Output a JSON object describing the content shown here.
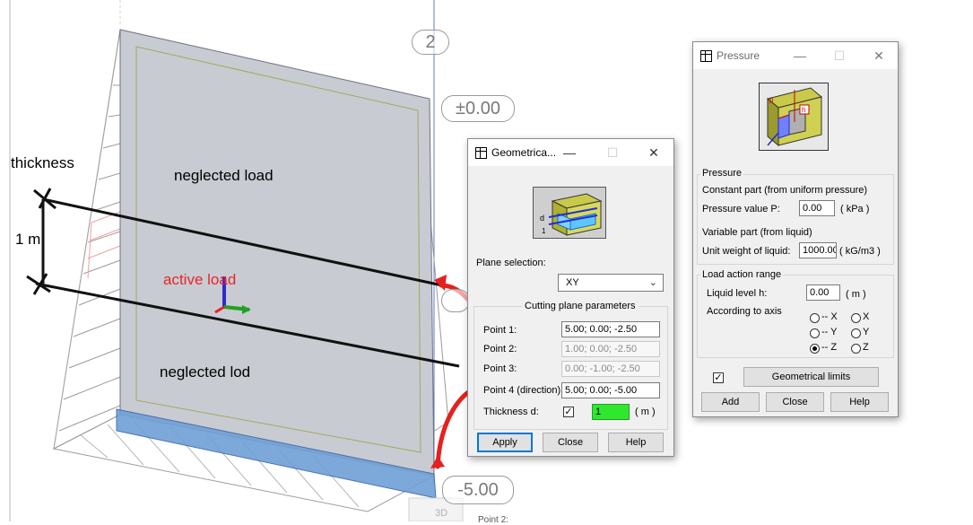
{
  "viewport": {
    "level_labels": [
      "2",
      "±0.00",
      "-5.00"
    ],
    "tab_label": "3D",
    "bottom_text": "Point 2:",
    "annotations": {
      "thickness": "thickness",
      "one_m": "1 m",
      "neglected_load_top": "neglected load",
      "active_load": "active load",
      "neglected_load_bottom": "neglected lod"
    },
    "colors": {
      "wall": "#c8cbd2",
      "foundation": "#6f9fd6",
      "active_load": "#e8262a",
      "arrow": "#e5211f"
    }
  },
  "geometrical": {
    "title": "Geometrica...",
    "plane_selection_label": "Plane selection:",
    "plane_value": "XY",
    "group_title": "Cutting plane parameters",
    "point1_label": "Point 1:",
    "point1_value": "5.00; 0.00; -2.50",
    "point2_label": "Point 2:",
    "point2_value": "1.00; 0.00; -2.50",
    "point3_label": "Point 3:",
    "point3_value": "0.00; -1.00; -2.50",
    "point4_label": "Point 4 (direction):",
    "point4_value": "5.00; 0.00; -5.00",
    "thickness_label": "Thickness d:",
    "thickness_value": "1",
    "thickness_unit": "( m )",
    "apply": "Apply",
    "close": "Close",
    "help": "Help"
  },
  "pressure": {
    "title": "Pressure",
    "group_pressure": "Pressure",
    "constant_part": "Constant part (from uniform pressure)",
    "pressure_value_label": "Pressure value P:",
    "pressure_value": "0.00",
    "pressure_unit": "( kPa )",
    "variable_part": "Variable part (from liquid)",
    "unit_weight_label": "Unit weight of liquid:",
    "unit_weight_value": "1000.00",
    "unit_weight_unit": "( kG/m3 )",
    "group_load_range": "Load action range",
    "liquid_level_label": "Liquid level h:",
    "liquid_level_value": "0.00",
    "liquid_level_unit": "( m )",
    "according_axis": "According to axis",
    "axis_options": [
      "-- X",
      "X",
      "-- Y",
      "Y",
      "-- Z",
      "Z"
    ],
    "axis_selected": "-- Z",
    "geometrical_limits": "Geometrical limits",
    "add": "Add",
    "close": "Close",
    "help": "Help"
  }
}
